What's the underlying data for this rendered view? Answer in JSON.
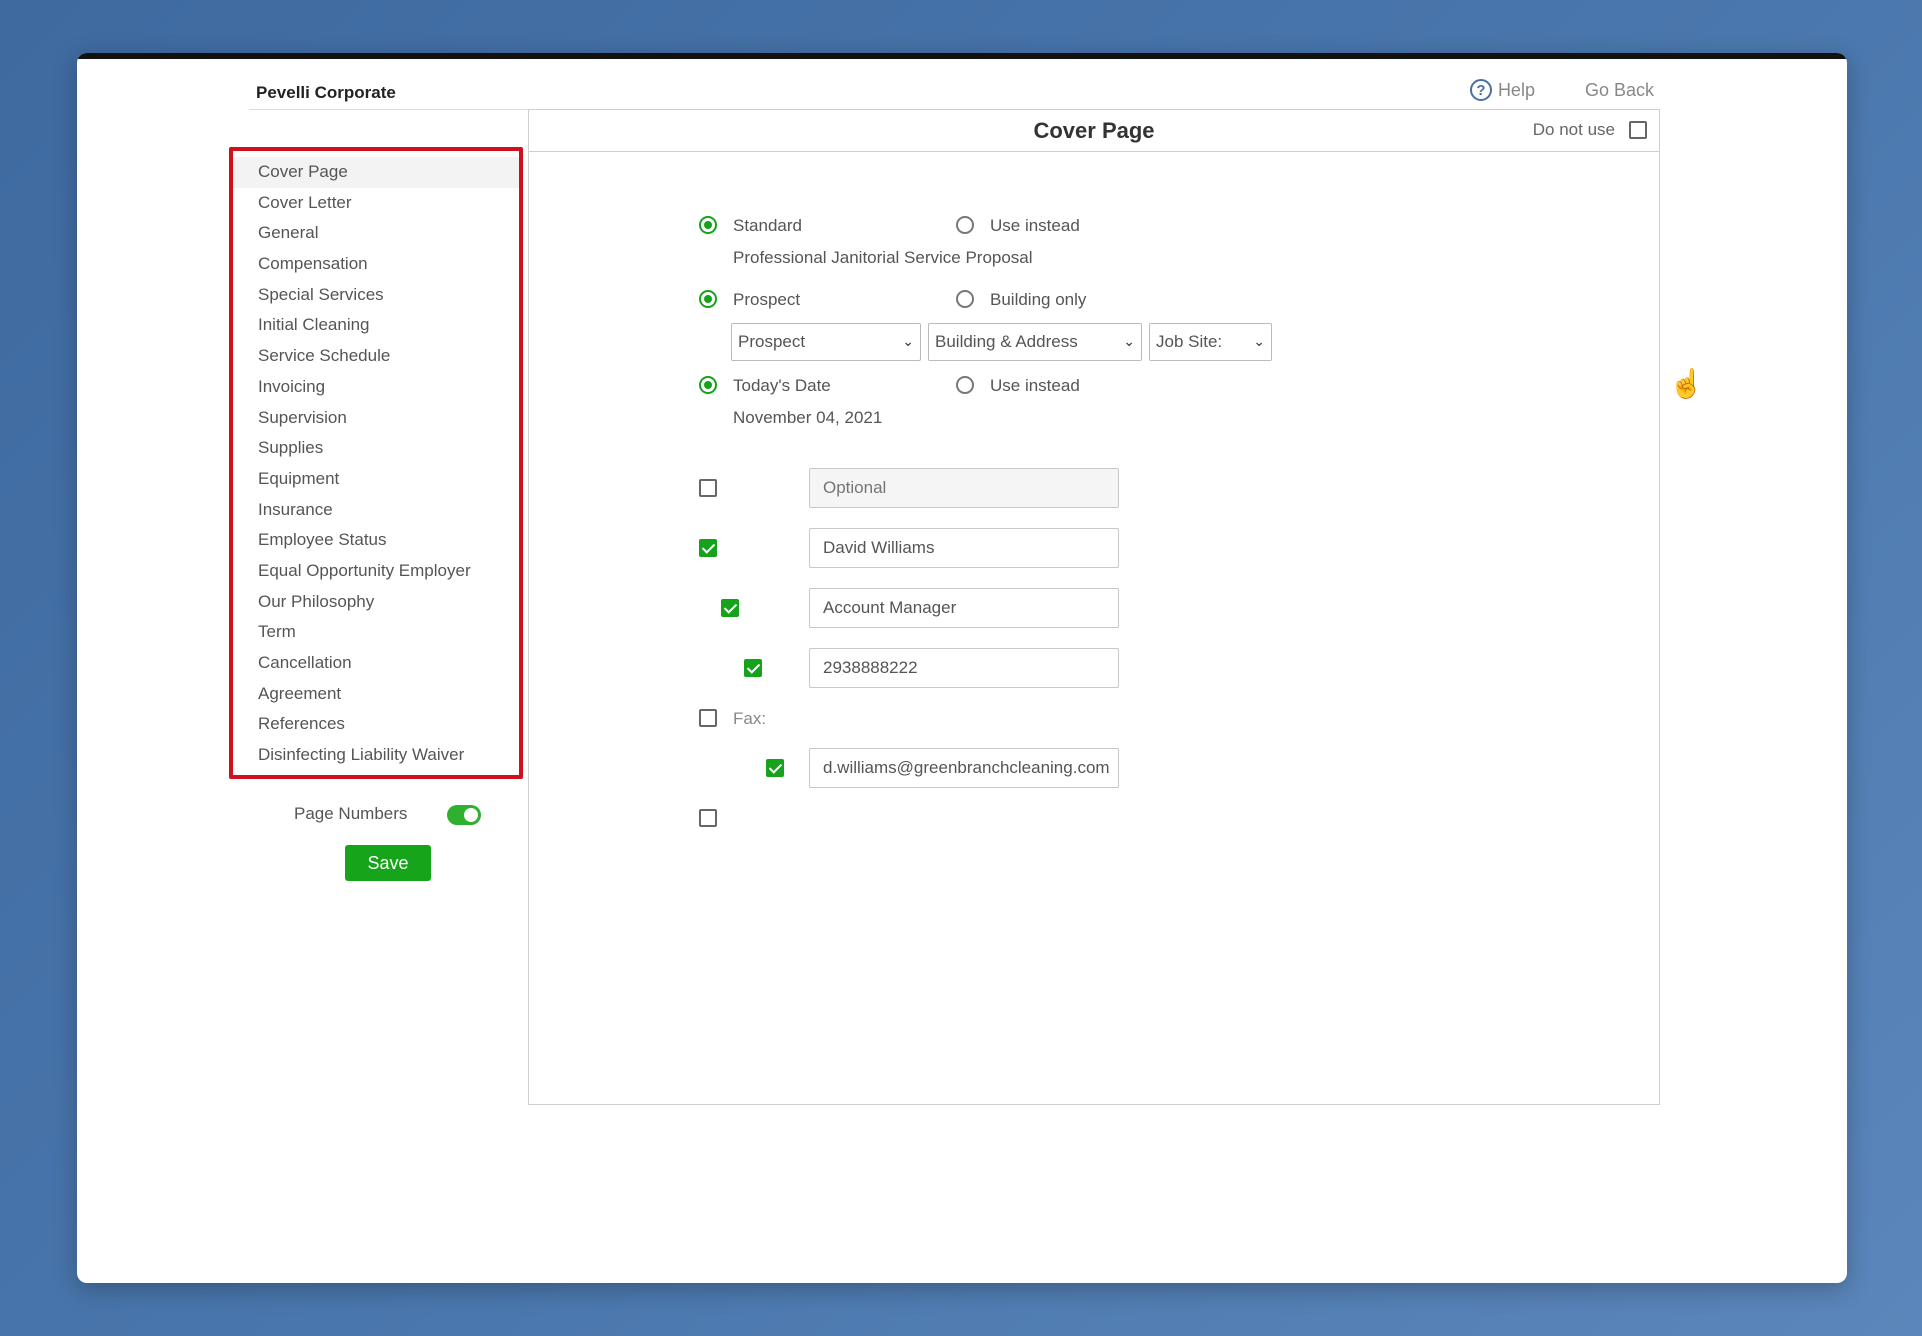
{
  "header": {
    "brand": "Pevelli Corporate",
    "help_label": "Help",
    "goback_label": "Go Back"
  },
  "sidebar": {
    "items": [
      {
        "label": "Cover Page",
        "active": true
      },
      {
        "label": "Cover Letter"
      },
      {
        "label": "General"
      },
      {
        "label": "Compensation"
      },
      {
        "label": "Special Services"
      },
      {
        "label": "Initial Cleaning"
      },
      {
        "label": "Service Schedule"
      },
      {
        "label": "Invoicing"
      },
      {
        "label": "Supervision"
      },
      {
        "label": "Supplies"
      },
      {
        "label": "Equipment"
      },
      {
        "label": "Insurance"
      },
      {
        "label": "Employee Status"
      },
      {
        "label": "Equal Opportunity Employer"
      },
      {
        "label": "Our Philosophy"
      },
      {
        "label": "Term"
      },
      {
        "label": "Cancellation"
      },
      {
        "label": "Agreement"
      },
      {
        "label": "References"
      },
      {
        "label": "Disinfecting Liability Waiver"
      }
    ],
    "page_numbers_label": "Page Numbers",
    "page_numbers_on": true,
    "save_label": "Save"
  },
  "panel": {
    "title": "Cover Page",
    "do_not_use_label": "Do not use",
    "title_options": {
      "standard_label": "Standard",
      "use_instead_label": "Use instead",
      "selected": "Standard",
      "standard_text": "Professional Janitorial Service Proposal"
    },
    "recipient_options": {
      "prospect_label": "Prospect",
      "building_only_label": "Building only",
      "selected": "Prospect",
      "selects": [
        "Prospect",
        "Building & Address",
        "Job Site:"
      ]
    },
    "date_options": {
      "today_label": "Today's Date",
      "use_instead_label": "Use instead",
      "selected": "Today's Date",
      "date_text": "November 04, 2021"
    },
    "fields": [
      {
        "checked": false,
        "placeholder": "Optional",
        "value": ""
      },
      {
        "checked": true,
        "value": "David Williams"
      },
      {
        "checked": true,
        "value": "Account Manager"
      },
      {
        "checked": true,
        "value": "2938888222"
      },
      {
        "checked": false,
        "label": "Fax:"
      },
      {
        "checked": true,
        "value": "d.williams@greenbranchcleaning.com"
      },
      {
        "checked": false
      }
    ]
  },
  "icons": {
    "help": "question-circle-icon",
    "cursor": "hand-pointer-icon",
    "chevron": "chevron-down-icon"
  },
  "colors": {
    "accent_green": "#16a51a",
    "highlight_red": "#d0101d"
  }
}
